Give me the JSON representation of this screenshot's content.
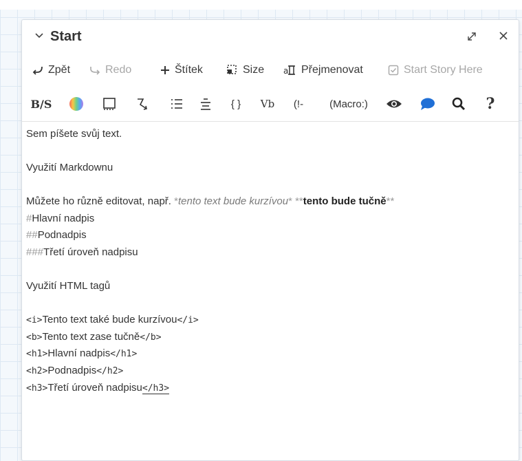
{
  "dialog": {
    "title": "Start"
  },
  "toolbar": {
    "back_label": "Zpět",
    "redo_label": "Redo",
    "tag_label": "Štítek",
    "size_label": "Size",
    "rename_label": "Přejmenovat",
    "start_story_label": "Start Story Here"
  },
  "format_toolbar": {
    "bold_strike": "B/S",
    "code": "{ }",
    "vb": "Vb",
    "comment": "(!-",
    "macro": "(Macro:)",
    "help": "?"
  },
  "editor": {
    "l1": "Sem píšete svůj text.",
    "l2": "Využití Markdownu",
    "l3_prefix": "Můžete ho různě editovat, např. ",
    "l3_ast1": "*",
    "l3_italic": "tento text bude kurzívou",
    "l3_ast2": "* **",
    "l3_bold": "tento bude tučně",
    "l3_ast3": "**",
    "l4_hash": "#",
    "l4_text": "Hlavní nadpis",
    "l5_hash": "##",
    "l5_text": "Podnadpis",
    "l6_hash": "###",
    "l6_text": "Třetí úroveň nadpisu",
    "l7": "Využití HTML tagů",
    "l8_open": "<i>",
    "l8_text": "Tento text také bude kurzívou",
    "l8_close": "</i>",
    "l9_open": "<b>",
    "l9_text": "Tento text zase tučně",
    "l9_close": "</b>",
    "l10_open": "<h1>",
    "l10_text": "Hlavní nadpis",
    "l10_close": "</h1>",
    "l11_open": "<h2>",
    "l11_text": "Podnadpis",
    "l11_close": "</h2>",
    "l12_open": "<h3>",
    "l12_text": "Třetí úroveň nadpisu",
    "l12_close": "</h3>"
  }
}
